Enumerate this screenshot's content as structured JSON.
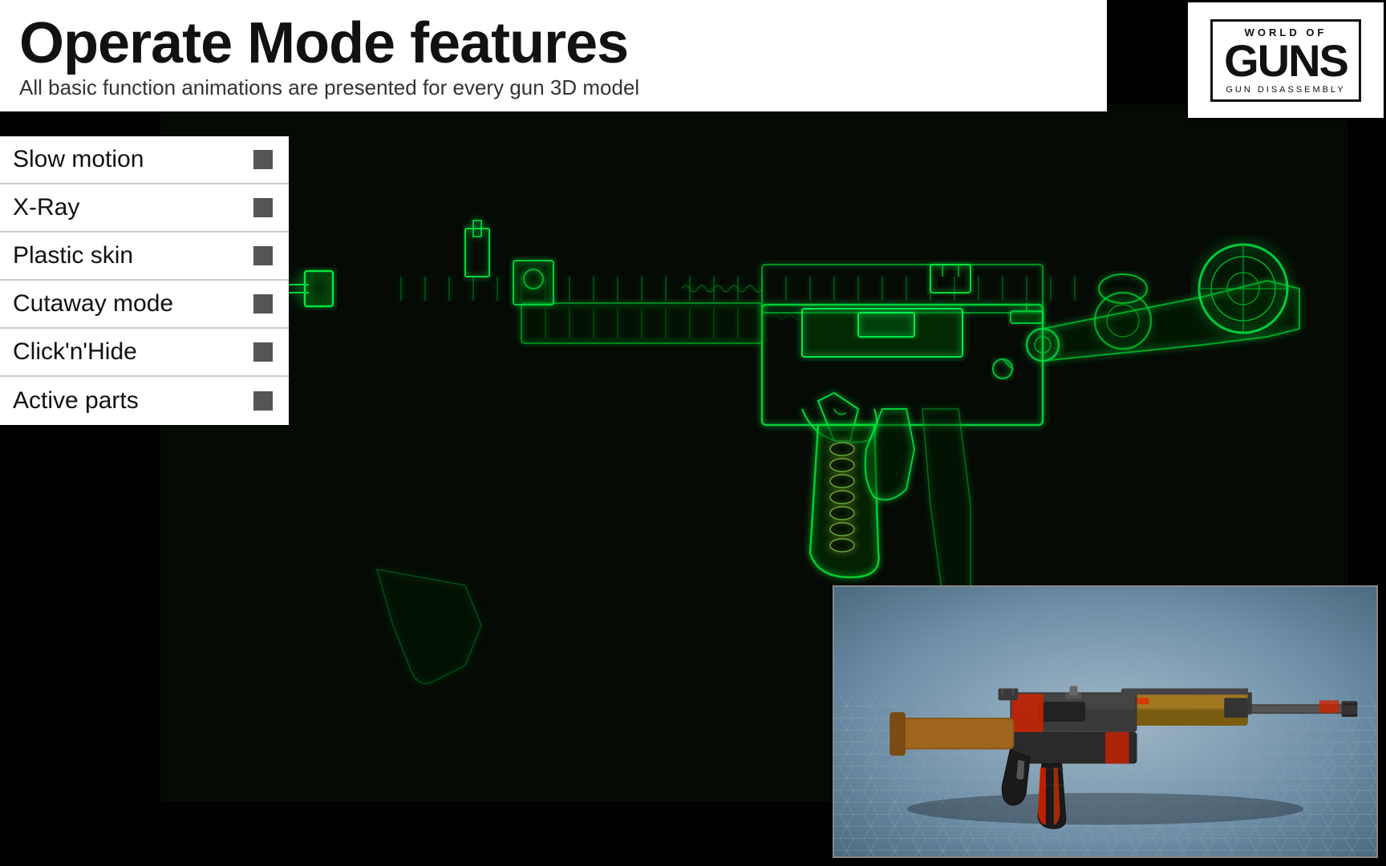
{
  "header": {
    "title": "Operate Mode features",
    "subtitle": "All basic function animations are presented for every gun 3D model"
  },
  "logo": {
    "world_of": "WORLD OF",
    "guns": "GUNS",
    "tagline": "GUN DISASSEMBLY"
  },
  "features": [
    {
      "label": "Slow motion",
      "icon": "square-icon"
    },
    {
      "label": "X-Ray",
      "icon": "square-icon"
    },
    {
      "label": "Plastic skin",
      "icon": "square-icon"
    },
    {
      "label": "Cutaway mode",
      "icon": "square-icon"
    },
    {
      "label": "Click'n'Hide",
      "icon": "square-icon"
    },
    {
      "label": "Active parts",
      "icon": "square-icon"
    }
  ],
  "colors": {
    "xray_green": "#00ff44",
    "xray_dark_green": "#003300",
    "background": "#000000",
    "header_bg": "#ffffff",
    "feature_bg": "#ffffff",
    "icon_color": "#555555"
  }
}
